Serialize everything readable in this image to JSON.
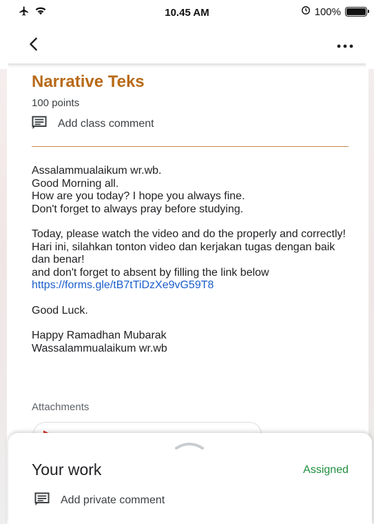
{
  "status_bar": {
    "time": "10.45 AM",
    "battery_text": "100%",
    "icons": [
      "airplane-icon",
      "wifi-icon",
      "alarm-icon",
      "battery-icon"
    ]
  },
  "app_bar": {
    "back_icon": "chevron-left-icon",
    "more_icon": "more-horizontal-icon"
  },
  "assignment": {
    "title": "Narrative Teks",
    "points": "100 points",
    "class_comment_label": "Add class comment",
    "accent_color": "#b86a18"
  },
  "body": {
    "line1": "Assalammualaikum wr.wb.",
    "line2": "Good Morning all.",
    "line3": "How are you today? I hope you always fine.",
    "line4": "Don't forget to always pray before studying.",
    "line5": "Today, please watch the video and do the properly and correctly!",
    "line6": "Hari ini, silahkan tonton video dan kerjakan tugas dengan baik dan benar!",
    "line7": "and don't forget to absent by filling the link below",
    "link": "https://forms.gle/tB7tTiDzXe9vG59T8",
    "line8": "Good Luck.",
    "line9": "Happy Ramadhan Mubarak",
    "line10": "Wassalammualaikum wr.wb"
  },
  "attachments": {
    "label": "Attachments"
  },
  "your_work": {
    "title": "Your work",
    "status": "Assigned",
    "status_color": "#1e8e3e",
    "private_comment_label": "Add private comment"
  }
}
